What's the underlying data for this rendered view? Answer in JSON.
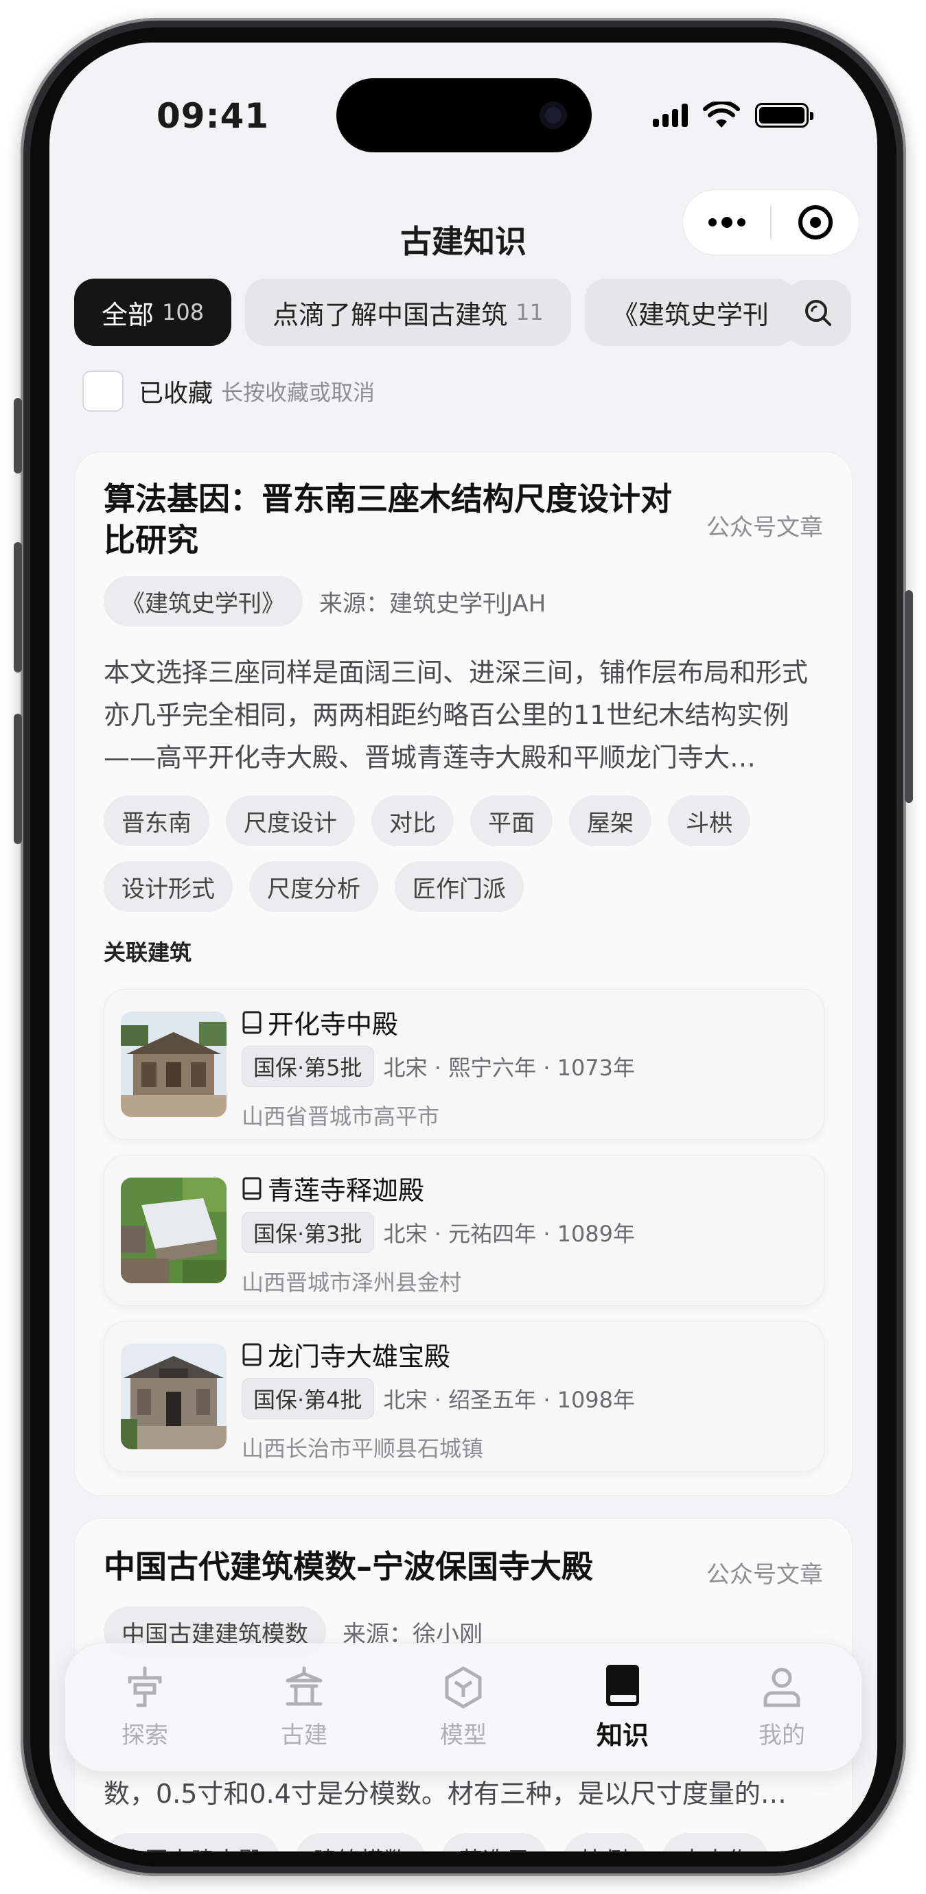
{
  "status_bar": {
    "time": "09:41"
  },
  "nav": {
    "title": "古建知识"
  },
  "filter_tabs": [
    {
      "label": "全部",
      "count": "108"
    },
    {
      "label": "点滴了解中国古建筑",
      "count": "11"
    },
    {
      "label": "《建筑史学刊",
      "count": ""
    }
  ],
  "favorites": {
    "label": "已收藏",
    "hint": "长按收藏或取消"
  },
  "articles": [
    {
      "title_line1": "算法基因：晋东南三座木结构尺度设计对",
      "title_line2": "比研究",
      "type": "公众号文章",
      "journal": "《建筑史学刊》",
      "source": "来源：建筑史学刊JAH",
      "summary": "本文选择三座同样是面阔三间、进深三间，铺作层布局和形式亦几乎完全相同，两两相距约略百公里的11世纪木结构实例——高平开化寺大殿、晋城青莲寺大殿和平顺龙门寺大…",
      "tags_row1": [
        "晋东南",
        "尺度设计",
        "对比",
        "平面",
        "屋架",
        "斗栱"
      ],
      "tags_row2": [
        "设计形式",
        "尺度分析",
        "匠作门派"
      ],
      "related_label": "关联建筑",
      "buildings": [
        {
          "name": "开化寺中殿",
          "badge": "国保·第5批",
          "period": "北宋 · 熙宁六年 · 1073年",
          "location": "山西省晋城市高平市"
        },
        {
          "name": "青莲寺释迦殿",
          "badge": "国保·第3批",
          "period": "北宋 · 元祐四年 · 1089年",
          "location": "山西晋城市泽州县金村"
        },
        {
          "name": "龙门寺大雄宝殿",
          "badge": "国保·第4批",
          "period": "北宋 · 绍圣五年 · 1098年",
          "location": "山西长治市平顺县石城镇"
        }
      ]
    },
    {
      "title": "中国古代建筑模数–宁波保国寺大殿",
      "type": "公众号文章",
      "journal": "中国古建建筑模数",
      "source": "来源：徐小刚",
      "summary_tail": "数，0.5寸和0.4寸是分模数。材有三种，是以尺寸度量的…",
      "tags_partial": [
        "中国古建大殿",
        "建筑模数",
        "营造尺",
        "比例",
        "大木作"
      ]
    }
  ],
  "tab_bar": [
    {
      "label": "探索",
      "icon": "compass-icon",
      "active": false
    },
    {
      "label": "古建",
      "icon": "pavilion-icon",
      "active": false
    },
    {
      "label": "模型",
      "icon": "cube-icon",
      "active": false
    },
    {
      "label": "知识",
      "icon": "book-icon",
      "active": true
    },
    {
      "label": "我的",
      "icon": "user-icon",
      "active": false
    }
  ],
  "colors": {
    "active_tab_bg": "#151515",
    "screen_bg": "#f3f3f5",
    "card_bg": "#fafafa",
    "inactive_icon": "#b0b0b4"
  }
}
